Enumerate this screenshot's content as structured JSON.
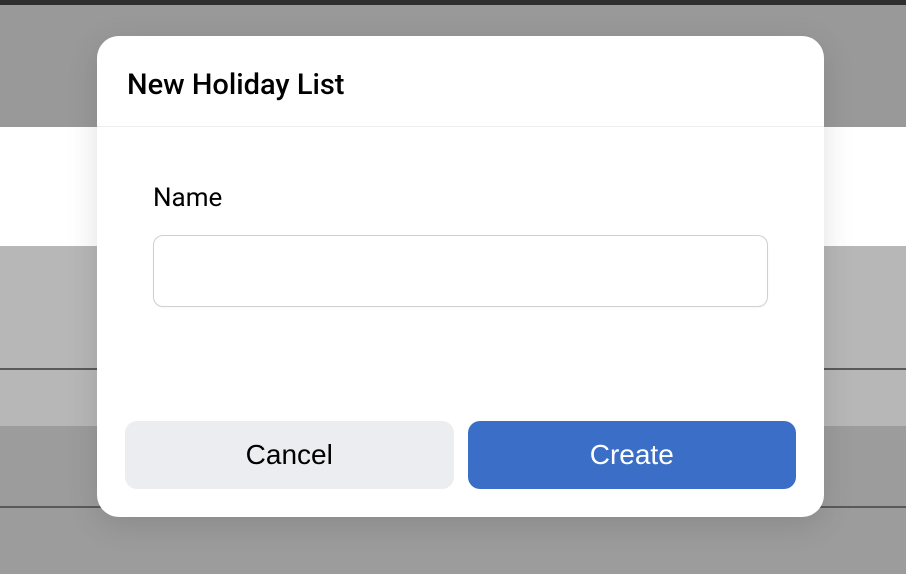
{
  "modal": {
    "title": "New Holiday List",
    "fields": {
      "name": {
        "label": "Name",
        "value": "",
        "placeholder": ""
      }
    },
    "actions": {
      "cancel_label": "Cancel",
      "create_label": "Create"
    }
  },
  "colors": {
    "primary": "#3b6fc7",
    "cancel_bg": "#ebedf0"
  }
}
